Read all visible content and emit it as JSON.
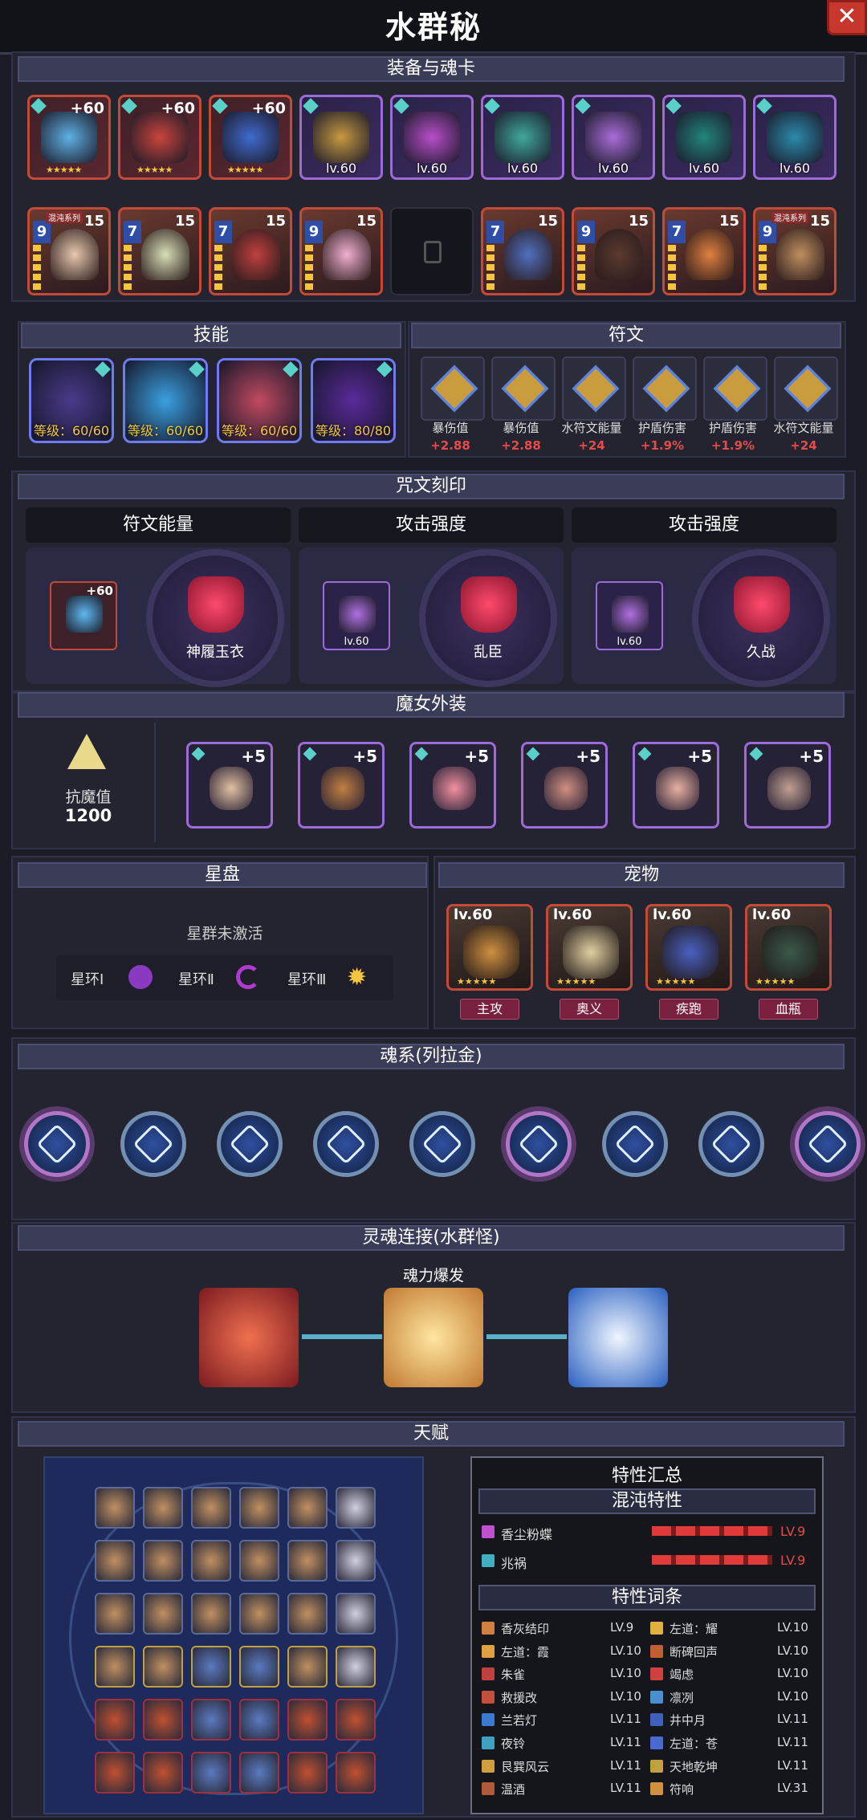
{
  "window": {
    "title": "水群秘",
    "close_icon": "close-icon"
  },
  "sections": {
    "equipment": "装备与魂卡",
    "skills": "技能",
    "runes": "符文",
    "inscription": "咒文刻印",
    "witch": "魔女外装",
    "starchart": "星盘",
    "pets": "宠物",
    "soul_system": "魂系(列拉金)",
    "soul_link": "灵魂连接(水群怪)",
    "talent": "天赋"
  },
  "equipment": [
    {
      "label": "+60",
      "rarity": "red",
      "color": "#5fb8f0"
    },
    {
      "label": "+60",
      "rarity": "red",
      "color": "#d0463c"
    },
    {
      "label": "+60",
      "rarity": "red",
      "color": "#3f6fd8"
    },
    {
      "label": "lv.60",
      "rarity": "purple",
      "color": "#d0a040"
    },
    {
      "label": "lv.60",
      "rarity": "purple",
      "color": "#c050d0"
    },
    {
      "label": "lv.60",
      "rarity": "purple",
      "color": "#40b0a0"
    },
    {
      "label": "lv.60",
      "rarity": "purple",
      "color": "#b070e0"
    },
    {
      "label": "lv.60",
      "rarity": "purple",
      "color": "#208a80"
    },
    {
      "label": "lv.60",
      "rarity": "purple",
      "color": "#2a90b0"
    }
  ],
  "soul_cards": [
    {
      "rank": "9",
      "count": "15",
      "tag": "混沌系列",
      "color": "#e8c8b0"
    },
    {
      "rank": "7",
      "count": "15",
      "tag": "",
      "color": "#d8e0b8"
    },
    {
      "rank": "7",
      "count": "15",
      "tag": "",
      "color": "#c04040"
    },
    {
      "rank": "9",
      "count": "15",
      "tag": "",
      "color": "#f0b0d0"
    },
    null,
    {
      "rank": "7",
      "count": "15",
      "tag": "",
      "color": "#5070c0"
    },
    {
      "rank": "9",
      "count": "15",
      "tag": "",
      "color": "#5a3a30"
    },
    {
      "rank": "7",
      "count": "15",
      "tag": "",
      "color": "#e08040"
    },
    {
      "rank": "9",
      "count": "15",
      "tag": "混沌系列",
      "color": "#c09060"
    }
  ],
  "skills": [
    {
      "level": "等级：60/60",
      "color": "#4a3a8a"
    },
    {
      "level": "等级：60/60",
      "color": "#3aa0e0"
    },
    {
      "level": "等级：60/60",
      "color": "#c04a60"
    },
    {
      "level": "等级：80/80",
      "color": "#5a2a9a"
    }
  ],
  "runes": [
    {
      "name": "暴伤值",
      "value": "+2.88"
    },
    {
      "name": "暴伤值",
      "value": "+2.88"
    },
    {
      "name": "水符文能量",
      "value": "+24"
    },
    {
      "name": "护盾伤害",
      "value": "+1.9%"
    },
    {
      "name": "护盾伤害",
      "value": "+1.9%"
    },
    {
      "name": "水符文能量",
      "value": "+24"
    }
  ],
  "inscriptions": [
    {
      "title": "符文能量",
      "item": "+60",
      "gem": "神履玉衣"
    },
    {
      "title": "攻击强度",
      "item": "lv.60",
      "gem": "乱臣"
    },
    {
      "title": "攻击强度",
      "item": "lv.60",
      "gem": "久战"
    }
  ],
  "witch": {
    "stat_label": "抗魔值",
    "stat_value": "1200",
    "items": [
      "+5",
      "+5",
      "+5",
      "+5",
      "+5",
      "+5"
    ]
  },
  "starchart": {
    "status": "星群未激活",
    "rings": [
      "星环Ⅰ",
      "星环Ⅱ",
      "星环Ⅲ"
    ]
  },
  "pets": [
    {
      "level": "lv.60",
      "role": "主攻",
      "color": "#d09040"
    },
    {
      "level": "lv.60",
      "role": "奥义",
      "color": "#e0d0a0"
    },
    {
      "level": "lv.60",
      "role": "疾跑",
      "color": "#4a60c0"
    },
    {
      "level": "lv.60",
      "role": "血瓶",
      "color": "#3a5a4a"
    }
  ],
  "soul_link": {
    "label": "魂力爆发"
  },
  "traits": {
    "summary_title": "特性汇总",
    "chaos_title": "混沌特性",
    "chaos": [
      {
        "name": "香尘粉蝶",
        "level": "LV.9"
      },
      {
        "name": "兆祸",
        "level": "LV.9"
      }
    ],
    "entries_title": "特性词条",
    "left": [
      {
        "name": "香灰结印",
        "level": "LV.9"
      },
      {
        "name": "左道：霞",
        "level": "LV.10"
      },
      {
        "name": "朱雀",
        "level": "LV.10"
      },
      {
        "name": "救援改",
        "level": "LV.10"
      },
      {
        "name": "兰若灯",
        "level": "LV.11"
      },
      {
        "name": "夜铃",
        "level": "LV.11"
      },
      {
        "name": "艮巽风云",
        "level": "LV.11"
      },
      {
        "name": "温酒",
        "level": "LV.11"
      }
    ],
    "right": [
      {
        "name": "左道：耀",
        "level": "LV.10"
      },
      {
        "name": "断碑回声",
        "level": "LV.10"
      },
      {
        "name": "竭虑",
        "level": "LV.10"
      },
      {
        "name": "凛冽",
        "level": "LV.10"
      },
      {
        "name": "井中月",
        "level": "LV.11"
      },
      {
        "name": "左道：苍",
        "level": "LV.11"
      },
      {
        "name": "天地乾坤",
        "level": "LV.11"
      },
      {
        "name": "符响",
        "level": "LV.31"
      }
    ]
  }
}
